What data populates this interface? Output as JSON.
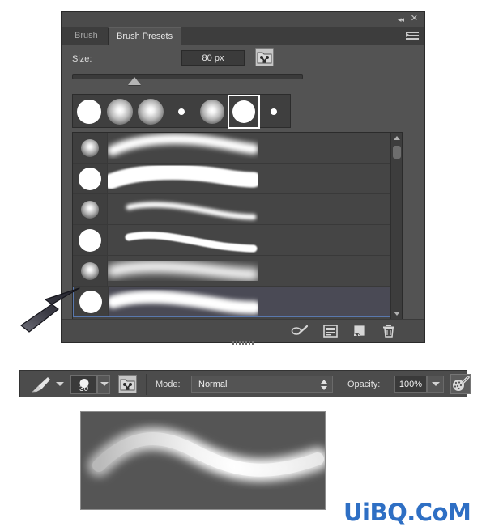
{
  "panel": {
    "titlebar": {
      "collapse_label": "◂◂",
      "close_label": "✕",
      "collapse_icon": "double-left-arrow-icon",
      "close_icon": "close-icon",
      "menu_icon": "panel-menu-icon"
    },
    "tabs": [
      {
        "label": "Brush",
        "active": false
      },
      {
        "label": "Brush Presets",
        "active": true
      }
    ],
    "size": {
      "label": "Size:",
      "value": "80 px",
      "slider_percent": 30,
      "tablet_pressure_icon": "tablet-pressure-icon"
    },
    "tips": [
      {
        "name": "tip-hard-round-large",
        "diameter": 30,
        "hardness": "hard",
        "selected": false
      },
      {
        "name": "tip-soft-round-large",
        "diameter": 32,
        "hardness": "soft",
        "selected": false
      },
      {
        "name": "tip-soft-round-medium",
        "diameter": 32,
        "hardness": "soft",
        "selected": false
      },
      {
        "name": "tip-hard-round-small",
        "diameter": 8,
        "hardness": "hard",
        "selected": false
      },
      {
        "name": "tip-soft-round-medium-2",
        "diameter": 30,
        "hardness": "soft",
        "selected": false
      },
      {
        "name": "tip-hard-round-selected",
        "diameter": 28,
        "hardness": "hard",
        "selected": true
      },
      {
        "name": "tip-hard-round-tiny",
        "diameter": 8,
        "hardness": "hard",
        "selected": false
      }
    ],
    "presets": [
      {
        "name": "preset-soft-round-1",
        "thumb_size": 22,
        "thumb_soft": true,
        "stroke": "soft-tapered",
        "selected": false
      },
      {
        "name": "preset-hard-round-2",
        "thumb_size": 28,
        "thumb_soft": false,
        "stroke": "hard-thick",
        "selected": false
      },
      {
        "name": "preset-soft-round-3",
        "thumb_size": 22,
        "thumb_soft": true,
        "stroke": "soft-thin",
        "selected": false
      },
      {
        "name": "preset-hard-round-4",
        "thumb_size": 28,
        "thumb_soft": false,
        "stroke": "hard-thin",
        "selected": false
      },
      {
        "name": "preset-soft-round-5",
        "thumb_size": 22,
        "thumb_soft": true,
        "stroke": "very-soft",
        "selected": false
      },
      {
        "name": "preset-soft-round-6",
        "thumb_size": 28,
        "thumb_soft": false,
        "stroke": "soft-thick",
        "selected": true
      }
    ],
    "scrollbar": {
      "up_icon": "scroll-up-arrow-icon",
      "down_icon": "scroll-down-arrow-icon",
      "thumb_position_percent": 5
    },
    "footer": {
      "icons": [
        {
          "name": "toggle-brush-preview-icon",
          "glyph": "brush-preview"
        },
        {
          "name": "open-preset-manager-icon",
          "glyph": "preset-manager"
        },
        {
          "name": "create-new-brush-icon",
          "glyph": "new-brush"
        },
        {
          "name": "delete-brush-icon",
          "glyph": "trash"
        }
      ],
      "resize_grip_icon": "resize-grip-icon"
    }
  },
  "options_bar": {
    "tool_icon": "brush-tool-icon",
    "tool_dropdown_icon": "chevron-down-icon",
    "brush_preview_value": "30",
    "brush_dropdown_icon": "chevron-down-icon",
    "tablet_pressure_icon": "tablet-pressure-icon",
    "mode_label": "Mode:",
    "mode_value": "Normal",
    "mode_spinner_icon": "spinner-up-down-icon",
    "opacity_label": "Opacity:",
    "opacity_value": "100%",
    "opacity_dropdown_icon": "chevron-down-icon",
    "airbrush_icon": "airbrush-icon"
  },
  "canvas": {
    "name": "brush-stroke-preview",
    "background_color": "#555555",
    "stroke_color": "#ffffff"
  },
  "pointer": {
    "name": "mouse-cursor-arrow",
    "color": "#2a2a33"
  },
  "watermark": {
    "text": "UiBQ.CoM",
    "color": "#2e6fc4"
  }
}
